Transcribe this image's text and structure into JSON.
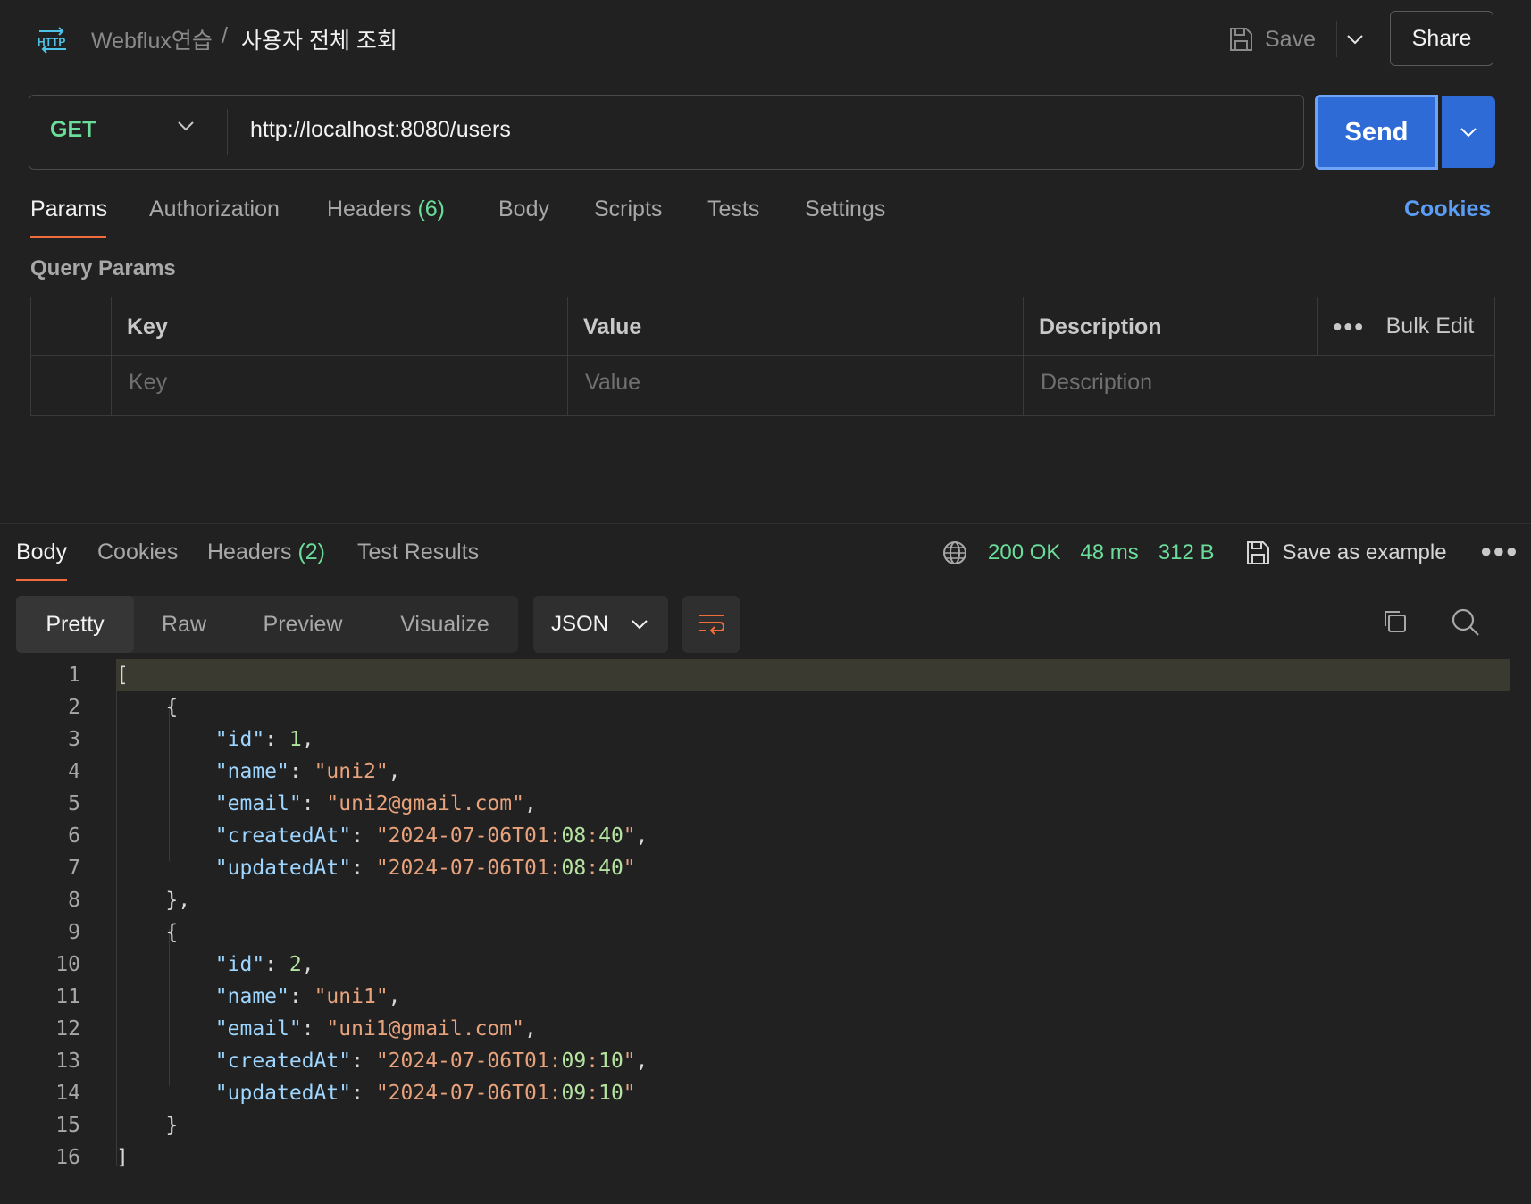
{
  "header": {
    "icon": "http-icon",
    "collection": "Webflux연습",
    "separator": "/",
    "request_name": "사용자 전체 조회",
    "save_label": "Save",
    "share_label": "Share"
  },
  "request": {
    "method": "GET",
    "url": "http://localhost:8080/users",
    "send_label": "Send"
  },
  "request_tabs": {
    "params": "Params",
    "authorization": "Authorization",
    "headers": "Headers",
    "headers_count": "(6)",
    "body": "Body",
    "scripts": "Scripts",
    "tests": "Tests",
    "settings": "Settings",
    "cookies": "Cookies"
  },
  "params": {
    "section_title": "Query Params",
    "col_key": "Key",
    "col_value": "Value",
    "col_description": "Description",
    "bulk_edit": "Bulk Edit",
    "ph_key": "Key",
    "ph_value": "Value",
    "ph_description": "Description"
  },
  "response_tabs": {
    "body": "Body",
    "cookies": "Cookies",
    "headers": "Headers",
    "headers_count": "(2)",
    "test_results": "Test Results"
  },
  "response_status": {
    "status": "200 OK",
    "time": "48 ms",
    "size": "312 B",
    "save_example": "Save as example"
  },
  "view": {
    "pretty": "Pretty",
    "raw": "Raw",
    "preview": "Preview",
    "visualize": "Visualize",
    "format": "JSON"
  },
  "code_lines": [
    {
      "n": "1",
      "t": "["
    },
    {
      "n": "2",
      "t": "    {"
    },
    {
      "n": "3",
      "t": "        \"id\": 1,"
    },
    {
      "n": "4",
      "t": "        \"name\": \"uni2\","
    },
    {
      "n": "5",
      "t": "        \"email\": \"uni2@gmail.com\","
    },
    {
      "n": "6",
      "t": "        \"createdAt\": \"2024-07-06T01:08:40\","
    },
    {
      "n": "7",
      "t": "        \"updatedAt\": \"2024-07-06T01:08:40\""
    },
    {
      "n": "8",
      "t": "    },"
    },
    {
      "n": "9",
      "t": "    {"
    },
    {
      "n": "10",
      "t": "        \"id\": 2,"
    },
    {
      "n": "11",
      "t": "        \"name\": \"uni1\","
    },
    {
      "n": "12",
      "t": "        \"email\": \"uni1@gmail.com\","
    },
    {
      "n": "13",
      "t": "        \"createdAt\": \"2024-07-06T01:09:10\","
    },
    {
      "n": "14",
      "t": "        \"updatedAt\": \"2024-07-06T01:09:10\""
    },
    {
      "n": "15",
      "t": "    }"
    },
    {
      "n": "16",
      "t": "]"
    }
  ],
  "colors": {
    "accent_tab": "#f26b3a",
    "method": "#6bdd9a",
    "send": "#2e6bd6",
    "status_ok": "#6bdd9a",
    "link": "#5b9cf5"
  }
}
